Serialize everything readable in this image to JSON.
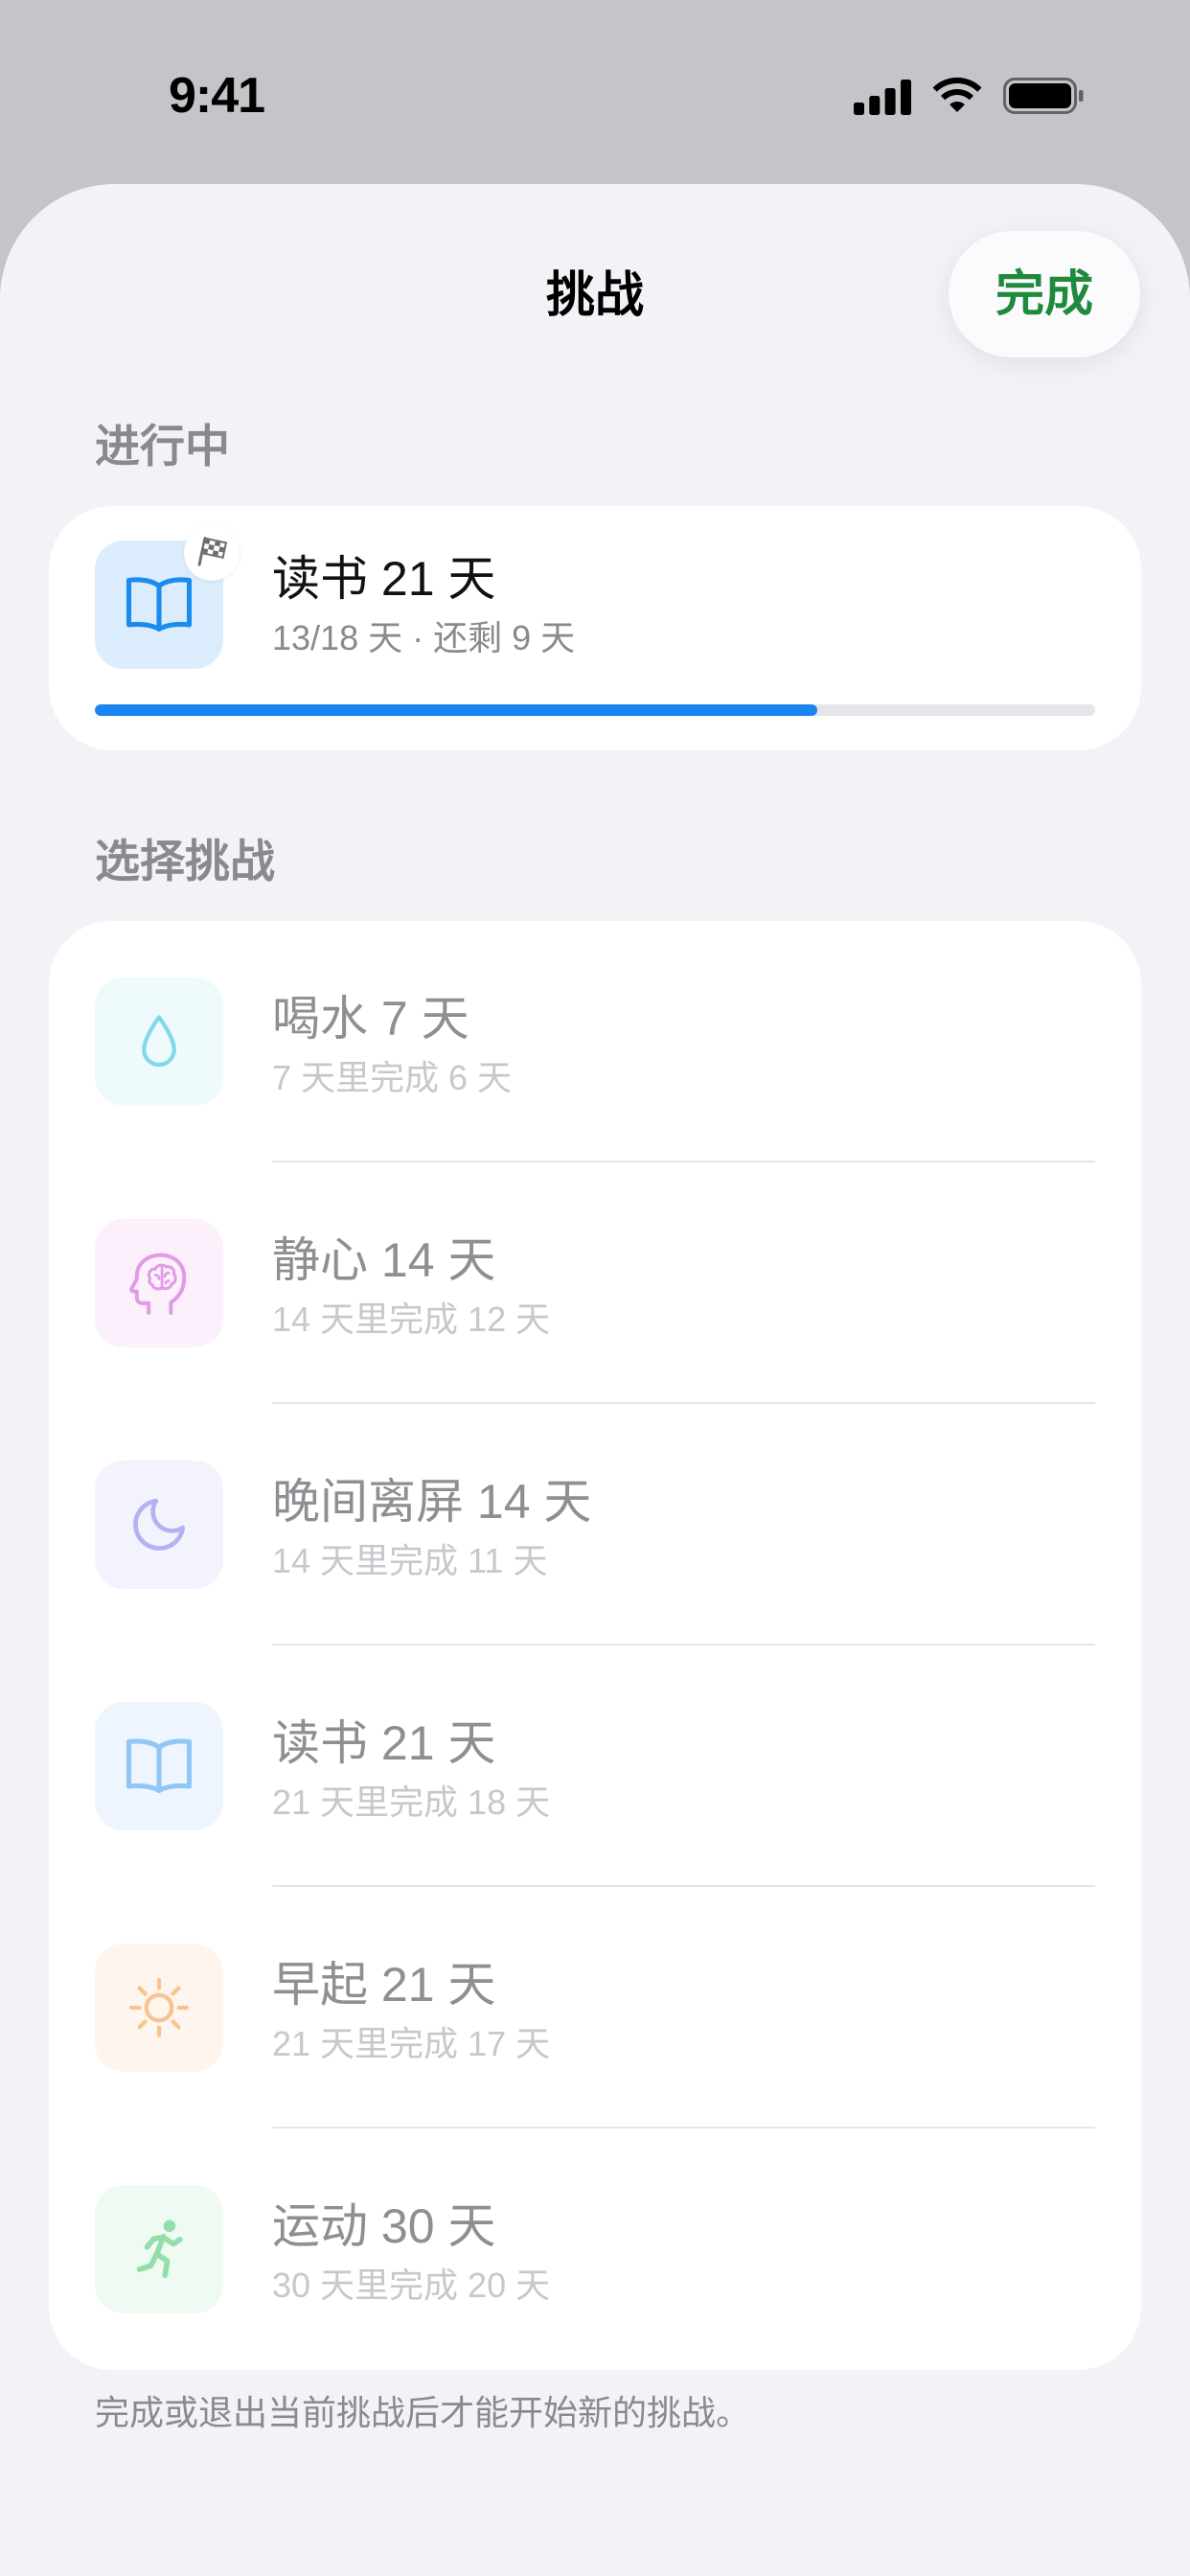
{
  "status_bar": {
    "time": "9:41",
    "icons": [
      "cellular-signal-icon",
      "wifi-icon",
      "battery-icon"
    ]
  },
  "nav": {
    "title": "挑战",
    "done_label": "完成"
  },
  "in_progress": {
    "header": "进行中",
    "challenge": {
      "title": "读书 21 天",
      "subtitle": "13/18 天 · 还剩 9 天",
      "icon": "book-icon",
      "badge_icon": "checkered-flag-icon",
      "progress": 0.722,
      "tile_color": "#dbedfd",
      "icon_color": "#1a8cf0"
    }
  },
  "choose": {
    "header": "选择挑战",
    "challenges": [
      {
        "title": "喝水 7 天",
        "subtitle": "7 天里完成 6 天",
        "icon": "water-drop-icon",
        "tile_color": "#eefafc",
        "icon_color": "#80d9ea"
      },
      {
        "title": "静心 14 天",
        "subtitle": "14 天里完成 12 天",
        "icon": "brain-head-icon",
        "tile_color": "#fcf0fd",
        "icon_color": "#e09ce5"
      },
      {
        "title": "晚间离屏 14 天",
        "subtitle": "14 天里完成 11 天",
        "icon": "moon-icon",
        "tile_color": "#f3f3fe",
        "icon_color": "#b6b1f3"
      },
      {
        "title": "读书 21 天",
        "subtitle": "21 天里完成 18 天",
        "icon": "book-icon",
        "tile_color": "#eef5fe",
        "icon_color": "#92c7f5"
      },
      {
        "title": "早起 21 天",
        "subtitle": "21 天里完成 17 天",
        "icon": "sun-icon",
        "tile_color": "#fef6ee",
        "icon_color": "#f8c391"
      },
      {
        "title": "运动 30 天",
        "subtitle": "30 天里完成 20 天",
        "icon": "running-figure-icon",
        "tile_color": "#eefaf2",
        "icon_color": "#93dea9"
      }
    ]
  },
  "footer_note": "完成或退出当前挑战后才能开始新的挑战。",
  "colors": {
    "status_bar_bg": "#c5c5c9",
    "sheet_bg": "#f2f2f7",
    "card_bg": "#ffffff",
    "done_green": "#1f8a3b",
    "accent_blue": "#1a85f0",
    "progress_track": "#e5e5ea",
    "secondary_text": "#8a8a8e",
    "dimmed_title": "#8e8e93",
    "dimmed_subtitle": "#c7c7cc",
    "separator": "#e5e5ea",
    "badge_icon": "#6e6e73"
  }
}
